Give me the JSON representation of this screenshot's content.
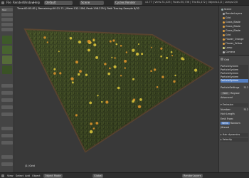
{
  "header": {
    "menus": [
      "File",
      "Render",
      "Window",
      "Help"
    ],
    "screen_layout": "Default",
    "scene": "Scene",
    "render_engine": "Cycles Render",
    "stats": "v2.77 | Verts:31,025 | Faces:30,736 | Tris:61,472 | Objects:1/2 | Lamps:0/0"
  },
  "viewport": {
    "info_line": "Time:00:05.81 | Remaining:00:21.71 | Mem:132.10M, Peak:198.27M | Path Tracing Sample 8/32",
    "corner_label": "(1) Grid",
    "colors": {
      "grass_dark": "#2f3a1c",
      "grass_mid": "#4d5a2c",
      "flower_orange": "#d8912a",
      "flower_yellow": "#d8c23a",
      "soil_edge": "#6b5034"
    }
  },
  "left_panel": {
    "tools": [
      "Tool",
      "",
      "",
      "",
      "",
      ""
    ],
    "thumb_colors": [
      "#3e5a2a",
      "#47632f",
      "#556b38",
      "#3a5226",
      "#4f6a32",
      "#445e2c",
      "#3d5628",
      "#536c36"
    ]
  },
  "outliner": {
    "items": [
      {
        "label": "Scene",
        "color": "#9aa"
      },
      {
        "label": "RenderLayers",
        "color": "#aaa"
      },
      {
        "label": "Grid",
        "color": "#e0a040"
      },
      {
        "label": "Grass_Blade",
        "color": "#e0a040"
      },
      {
        "label": "Grass_Blade",
        "color": "#e0a040"
      },
      {
        "label": "Grass_Blade",
        "color": "#e0a040"
      },
      {
        "label": "Grid",
        "color": "#e0a040"
      },
      {
        "label": "Flower_Orange",
        "color": "#e0a040"
      },
      {
        "label": "Flower_Yellow",
        "color": "#e0a040"
      },
      {
        "label": "Lamp",
        "color": "#dddd80"
      },
      {
        "label": "Camera",
        "color": "#bbb"
      }
    ]
  },
  "properties": {
    "header_label": "Grid",
    "particle_systems": [
      "ParticleSystem",
      "ParticleSystem",
      "ParticleSystem",
      "ParticleSystem",
      "ParticleSystem"
    ],
    "selected_index": 4,
    "settings_label": "ParticleSettings",
    "count_value": "512",
    "type_label": "Hair",
    "regrow_label": "Regrow",
    "advanced_label": "Advanced",
    "emission_label": "Emission",
    "number_label": "Number:",
    "number_value": "512",
    "hair_length_label": "Hair Length",
    "emit_from_label": "Emit From:",
    "verts_label": "Verts",
    "random_label": "Random",
    "jittered_label": "Jittered",
    "hair_dynamics_label": "Hair dynamics",
    "velocity_label": "Velocity"
  },
  "bottom_bar": {
    "view": "View",
    "select": "Select",
    "add": "Add",
    "object": "Object",
    "mode": "Object Mode",
    "global": "Global",
    "layers_label": "",
    "render_layer": "RenderLayers"
  }
}
